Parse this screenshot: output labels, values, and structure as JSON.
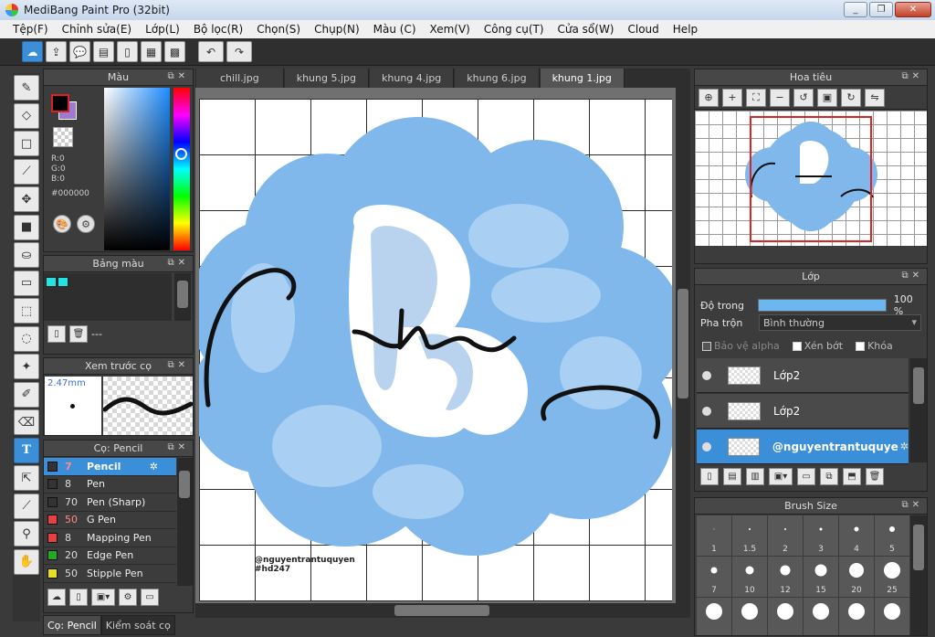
{
  "window": {
    "title": "MediBang Paint Pro (32bit)",
    "min": "_",
    "max": "❐",
    "close": "✕"
  },
  "menu": [
    "Tệp(F)",
    "Chỉnh sửa(E)",
    "Lớp(L)",
    "Bộ lọc(R)",
    "Chọn(S)",
    "Chụp(N)",
    "Màu (C)",
    "Xem(V)",
    "Công cụ(T)",
    "Cửa sổ(W)",
    "Cloud",
    "Help"
  ],
  "color_panel": {
    "title": "Màu",
    "r": "R:0",
    "g": "G:0",
    "b": "B:0",
    "hex": "#000000",
    "fg": "#000000",
    "bg": "#a07ad0"
  },
  "palette_panel": {
    "title": "Bảng màu",
    "chip_color": "#23e3e3",
    "status": "---"
  },
  "brush_preview": {
    "title": "Xem trước cọ",
    "size": "2.47mm"
  },
  "brush_panel": {
    "title": "Cọ: Pencil",
    "items": [
      {
        "size": "7",
        "name": "Pencil",
        "color": "#333333",
        "active": true
      },
      {
        "size": "8",
        "name": "Pen",
        "color": "#333333"
      },
      {
        "size": "70",
        "name": "Pen (Sharp)",
        "color": "#333333"
      },
      {
        "size": "50",
        "name": "G Pen",
        "color": "#e84040"
      },
      {
        "size": "8",
        "name": "Mapping Pen",
        "color": "#e84040"
      },
      {
        "size": "20",
        "name": "Edge Pen",
        "color": "#22aa22"
      },
      {
        "size": "50",
        "name": "Stipple Pen",
        "color": "#e8e020"
      }
    ]
  },
  "bottom_tabs": [
    "Cọ: Pencil",
    "Kiểm soát cọ"
  ],
  "tabs": [
    "chill.jpg",
    "khung 5.jpg",
    "khung 4.jpg",
    "khung 6.jpg",
    "khung 1.jpg"
  ],
  "canvas": {
    "credit_line1": "@nguyentrantuquyen",
    "credit_line2": "#hd247"
  },
  "navigator": {
    "title": "Hoa tiêu"
  },
  "layer_panel": {
    "title": "Lớp",
    "opacity_label": "Độ trong",
    "opacity_value": "100 %",
    "opacity_fraction": 1.0,
    "blend_label": "Pha trộn",
    "blend_value": "Bình thường",
    "protect_alpha": "Bảo vệ alpha",
    "clip": "Xén bớt",
    "lock": "Khóa",
    "layers": [
      {
        "name": "Lớp2",
        "active": false
      },
      {
        "name": "Lớp2",
        "active": false
      },
      {
        "name": "@nguyentrantuquye",
        "active": true
      }
    ]
  },
  "brush_size": {
    "title": "Brush Size",
    "sizes": [
      "1",
      "1.5",
      "2",
      "3",
      "4",
      "5",
      "7",
      "10",
      "12",
      "15",
      "20",
      "25",
      "",
      "",
      "",
      "",
      "",
      ""
    ]
  }
}
